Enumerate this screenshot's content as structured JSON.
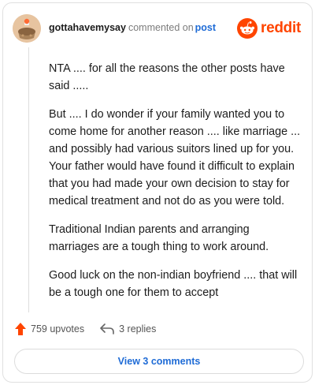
{
  "header": {
    "username": "gottahavemysay",
    "action_text": "commented on",
    "post_link": "post",
    "brand": "reddit"
  },
  "comment": {
    "paragraphs": [
      "NTA .... for all the reasons the other posts have said .....",
      "But .... I do wonder if your family wanted you to come home for another reason .... like marriage ... and possibly had various suitors lined up for you. Your father would have found it difficult to explain that you had made your own decision to stay for medical treatment and not do as you were told.",
      "Traditional Indian parents and arranging marriages are a tough thing to work around.",
      "Good luck on the non-indian boyfriend .... that will be a tough one for them to accept"
    ]
  },
  "actions": {
    "upvotes": "759 upvotes",
    "replies": "3 replies"
  },
  "footer": {
    "view_comments": "View 3 comments"
  },
  "colors": {
    "brand": "#ff4500",
    "link": "#1e6bd6",
    "muted": "#7c7c7c"
  },
  "icons": {
    "avatar": "snoo-avatar-icon",
    "brand": "reddit-logo-icon",
    "upvote": "upvote-arrow-icon",
    "reply": "reply-arrow-icon"
  }
}
